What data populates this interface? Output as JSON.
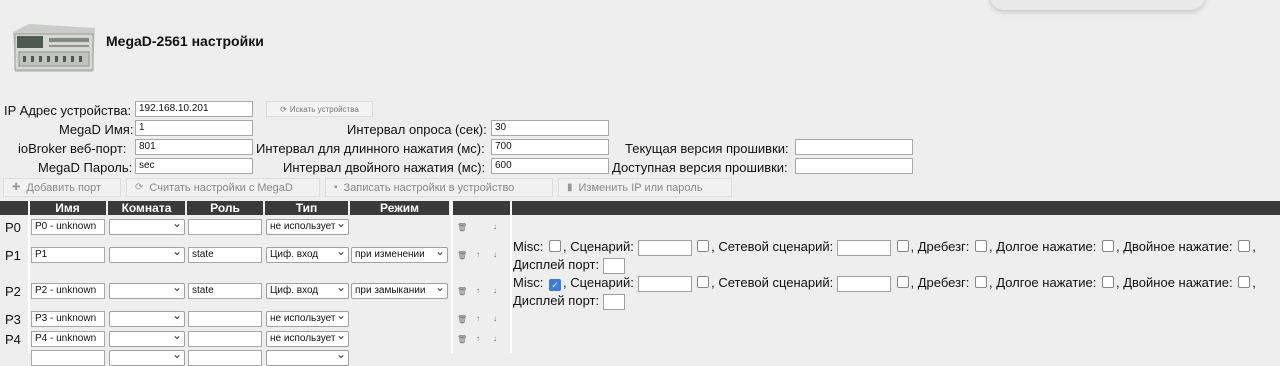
{
  "page": {
    "title": "MegaD-2561 настройки"
  },
  "settings": {
    "ip_label": "IP Адрес устройства:",
    "ip_value": "192.168.10.201",
    "search_button": "Искать устройства",
    "name_label": "MegaD Имя:",
    "name_value": "1",
    "port_label": "ioBroker веб-порт:",
    "port_value": "801",
    "password_label": "MegaD Пароль:",
    "password_value": "sec",
    "poll_label": "Интервал опроса (сек):",
    "poll_value": "30",
    "long_label": "Интервал для длинного нажатия (мс):",
    "long_value": "700",
    "double_label": "Интервал двойного нажатия (мс):",
    "double_value": "600",
    "fw_current_label": "Текущая версия прошивки:",
    "fw_current_value": "",
    "fw_available_label": "Доступная версия прошивки:",
    "fw_available_value": ""
  },
  "toolbar": {
    "add_port": "Добавить порт",
    "read_settings": "Считать настройки с MegaD",
    "write_settings": "Записать настройки в устройство",
    "change_ip": "Изменить IP или пароль"
  },
  "table": {
    "headers": [
      "Имя",
      "Комната",
      "Роль",
      "Тип",
      "Режим"
    ],
    "rows": [
      {
        "port": "P0",
        "name": "P0 - unknown",
        "room": "",
        "role": "",
        "type": "не использует",
        "mode": ""
      },
      {
        "port": "P1",
        "name": "P1",
        "room": "",
        "role": "state",
        "type": "Циф. вход",
        "mode": "при изменении"
      },
      {
        "port": "P2",
        "name": "P2 - unknown",
        "room": "",
        "role": "state",
        "type": "Циф. вход",
        "mode": "при замыкании"
      },
      {
        "port": "P3",
        "name": "P3 - unknown",
        "room": "",
        "role": "",
        "type": "не использует",
        "mode": ""
      },
      {
        "port": "P4",
        "name": "P4 - unknown",
        "room": "",
        "role": "",
        "type": "не использует",
        "mode": ""
      }
    ],
    "misc": {
      "misc": "Misc:",
      "scenario": ", Сценарий:",
      "net_scenario": ", Сетевой сценарий:",
      "debounce": ", Дребезг:",
      "long_press": ", Долгое нажатие:",
      "double_press": ", Двойное нажатие:",
      "comma": ",",
      "display_port": "Дисплей порт:",
      "p1_misc_checked": false,
      "p2_misc_checked": true
    }
  }
}
